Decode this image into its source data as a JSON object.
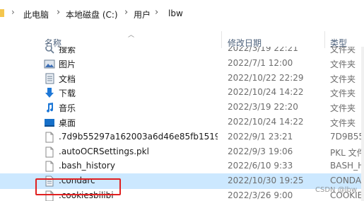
{
  "breadcrumb": {
    "separator": "›",
    "items": [
      "此电脑",
      "本地磁盘 (C:)",
      "用户",
      "lbw"
    ]
  },
  "columns": {
    "name": "名称",
    "modified": "修改日期",
    "type": "类型"
  },
  "files": [
    {
      "icon": "search-icon",
      "name": "搜索",
      "date": "2022/3/19 22:21",
      "type": "文件夹"
    },
    {
      "icon": "pictures-folder-icon",
      "name": "图片",
      "date": "2022/7/1 12:00",
      "type": "文件夹"
    },
    {
      "icon": "documents-folder-icon",
      "name": "文档",
      "date": "2022/10/22 22:29",
      "type": "文件夹"
    },
    {
      "icon": "downloads-folder-icon",
      "name": "下载",
      "date": "2022/10/24 14:22",
      "type": "文件夹"
    },
    {
      "icon": "music-folder-icon",
      "name": "音乐",
      "date": "2022/3/19 22:20",
      "type": "文件夹"
    },
    {
      "icon": "desktop-folder-icon",
      "name": "桌面",
      "date": "2022/10/24 14:22",
      "type": "文件夹"
    },
    {
      "icon": "file-icon",
      "name": ".7d9b55297a162003a6d46e85fb1519...",
      "date": "2022/9/1 23:21",
      "type": "7D9B55"
    },
    {
      "icon": "file-icon",
      "name": ".autoOCRSettings.pkl",
      "date": "2022/9/3 19:06",
      "type": "PKL 文件"
    },
    {
      "icon": "file-icon",
      "name": ".bash_history",
      "date": "2022/6/10 9:33",
      "type": "BASH_HI"
    },
    {
      "icon": "config-file-icon",
      "name": ".condarc",
      "date": "2022/10/30 19:25",
      "type": "CONDAR",
      "selected": true
    },
    {
      "icon": "file-icon",
      "name": ".cookiesbilibi",
      "date": "2022/3/26 9:00",
      "type": "COOKIE"
    }
  ],
  "watermark": "CSDN @lbw",
  "colors": {
    "selection": "#cce8ff",
    "highlight_border": "#e02020",
    "header_text": "#4c607a"
  }
}
